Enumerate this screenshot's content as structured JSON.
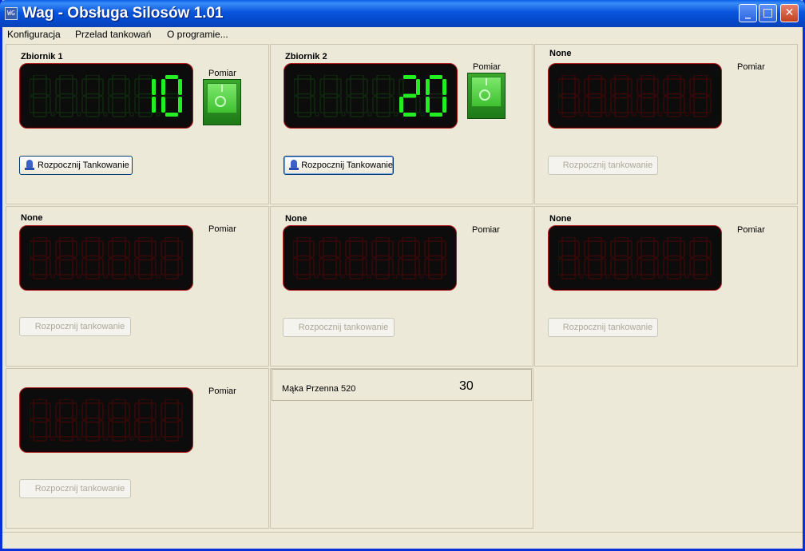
{
  "window": {
    "title": "Wag - Obsługa Silosów 1.01",
    "icon_text": "WG",
    "buttons": {
      "minimize": "_",
      "maximize": "□",
      "close": "✕"
    }
  },
  "menu": [
    "Konfiguracja",
    "Przelad tankowań",
    "O programie..."
  ],
  "colors": {
    "seg_on": "#22ee22",
    "seg_off_green": "#0f2a0f",
    "seg_off_red": "#3a0808"
  },
  "panels": [
    {
      "title": "Zbiornik 1",
      "pomiar": "Pomiar",
      "value": "10",
      "active": true,
      "button": "Rozpocznij Tankowanie"
    },
    {
      "title": "Zbiornik 2",
      "pomiar": "Pomiar",
      "value": "20",
      "active": true,
      "button": "Rozpocznij Tankowanie"
    },
    {
      "title": "None",
      "pomiar": "Pomiar",
      "value": "",
      "active": false,
      "button": "Rozpocznij tankowanie"
    },
    {
      "title": "None",
      "pomiar": "Pomiar",
      "value": "",
      "active": false,
      "button": "Rozpocznij tankowanie"
    },
    {
      "title": "None",
      "pomiar": "Pomiar",
      "value": "",
      "active": false,
      "button": "Rozpocznij tankowanie"
    },
    {
      "title": "None",
      "pomiar": "Pomiar",
      "value": "",
      "active": false,
      "button": "Rozpocznij tankowanie"
    },
    {
      "title": "",
      "pomiar": "Pomiar",
      "value": "",
      "active": false,
      "button": "Rozpocznij tankowanie"
    }
  ],
  "product": {
    "name": "Mąka Przenna 520",
    "value": "30"
  }
}
